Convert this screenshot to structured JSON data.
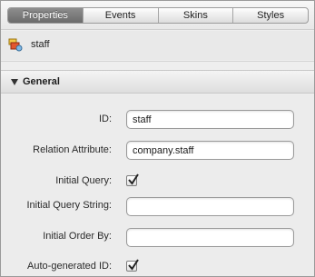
{
  "tabs": [
    {
      "label": "Properties",
      "active": true
    },
    {
      "label": "Events",
      "active": false
    },
    {
      "label": "Skins",
      "active": false
    },
    {
      "label": "Styles",
      "active": false
    }
  ],
  "component": {
    "name": "staff",
    "icon": "component-icon"
  },
  "section": {
    "title": "General",
    "expanded": true
  },
  "fields": {
    "id": {
      "label": "ID:",
      "value": "staff"
    },
    "relation_attribute": {
      "label": "Relation Attribute:",
      "value": "company.staff"
    },
    "initial_query": {
      "label": "Initial Query:",
      "checked": true
    },
    "initial_query_string": {
      "label": "Initial Query String:",
      "value": ""
    },
    "initial_order_by": {
      "label": "Initial Order By:",
      "value": ""
    },
    "auto_generated_id": {
      "label": "Auto-generated ID:",
      "checked": true
    }
  },
  "colors": {
    "active_tab": "#7a7a7a",
    "panel_bg": "#ececec",
    "header_bg": "#e6e6e6"
  }
}
